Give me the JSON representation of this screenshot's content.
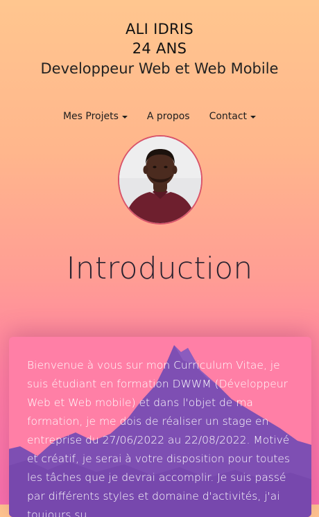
{
  "header": {
    "name": "ALI IDRIS",
    "age": "24 ANS",
    "job_title": "Developpeur Web et Web Mobile"
  },
  "nav": {
    "items": [
      {
        "label": "Mes Projets",
        "dropdown": true
      },
      {
        "label": "A propos",
        "dropdown": false
      },
      {
        "label": "Contact",
        "dropdown": true
      }
    ]
  },
  "intro": {
    "title": "Introduction",
    "text": "Bienvenue à vous sur mon Curriculum Vitae, je suis étudiant en formation DWWM (Développeur Web et Web mobile) et dans l'objet de ma formation, je me dois de réaliser un stage en entreprise du 27/06/2022 au 22/08/2022. Motivé et créatif, je serai à votre disposition pour toutes les tâches que je devrai accomplir. Je suis passé par différents styles et domaine d'activités, j'ai toujours su"
  },
  "colors": {
    "background_top": "#ffc68f",
    "background_bottom": "#f86fae",
    "card_pink": "#ff7fa6",
    "mountain_purple": "#7e4fb3",
    "avatar_border": "#d9546a"
  }
}
